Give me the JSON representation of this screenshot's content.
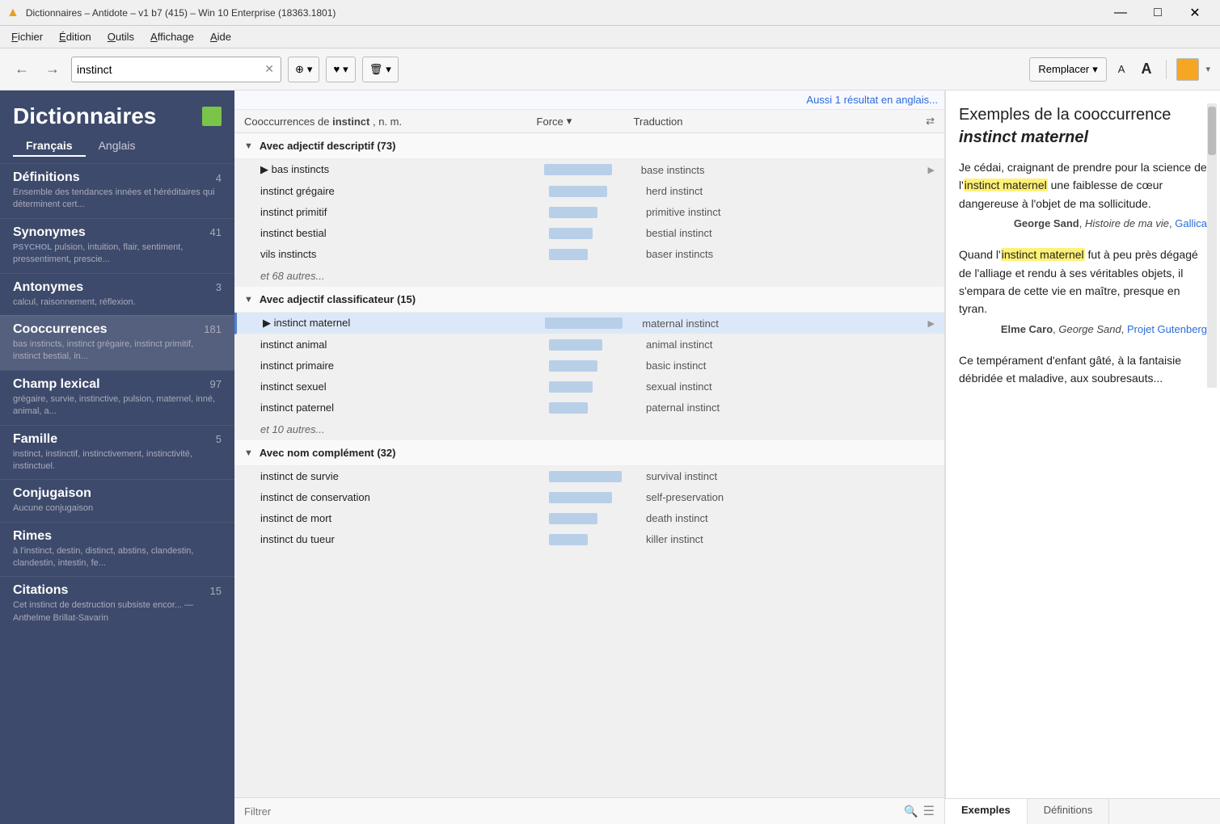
{
  "titleBar": {
    "icon": "▲",
    "title": "Dictionnaires – Antidote – v1 b7 (415) – Win 10 Enterprise (18363.1801)",
    "minimize": "—",
    "maximize": "□",
    "close": "✕"
  },
  "menuBar": {
    "items": [
      "Fichier",
      "Édition",
      "Outils",
      "Affichage",
      "Aide"
    ]
  },
  "toolbar": {
    "back": "←",
    "forward": "→",
    "searchValue": "instinct",
    "clear": "✕",
    "searchIcon": "⊕",
    "favoriteIcon": "♥",
    "deleteIcon": "🗑",
    "remplacer": "Remplacer",
    "fontSmall": "A",
    "fontLarge": "A",
    "dropdownArrow": "▾"
  },
  "sidebar": {
    "title": "Dictionnaires",
    "langTabs": [
      "Français",
      "Anglais"
    ],
    "activeLang": 0,
    "items": [
      {
        "title": "Définitions",
        "count": 4,
        "sub": "Ensemble des tendances innées et héréditaires qui déterminent cert..."
      },
      {
        "title": "Synonymes",
        "count": 41,
        "label": "PSYCHOL",
        "sub": "pulsion, intuition, flair, sentiment, pressentiment, prescie..."
      },
      {
        "title": "Antonymes",
        "count": 3,
        "sub": "calcul, raisonnement, réflexion."
      },
      {
        "title": "Cooccurrences",
        "count": 181,
        "sub": "bas instincts, instinct grégaire, instinct primitif, instinct bestial, in...",
        "active": true
      },
      {
        "title": "Champ lexical",
        "count": 97,
        "sub": "grégaire, survie, instinctive, pulsion, maternel, inné, animal, a..."
      },
      {
        "title": "Famille",
        "count": 5,
        "sub": "instinct, instinctif, instinctivement, instinctivité, instinctuel."
      },
      {
        "title": "Conjugaison",
        "count": null,
        "sub": "Aucune conjugaison"
      },
      {
        "title": "Rimes",
        "count": null,
        "sub": "à l'instinct, destin, distinct, abstins, clandestin, clandestin, intestin, fe..."
      },
      {
        "title": "Citations",
        "count": 15,
        "sub": "Cet instinct de destruction subsiste encor... — Anthelme Brillat-Savarin"
      }
    ]
  },
  "coocTable": {
    "englishLink": "Aussi 1 résultat en anglais...",
    "header": {
      "cooccurrences": "Cooccurrences de",
      "term": "instinct",
      "termSuffix": ", n. m.",
      "force": "Force",
      "traduction": "Traduction"
    },
    "sections": [
      {
        "title": "Avec adjectif descriptif (73)",
        "expanded": true,
        "rows": [
          {
            "fr": "bas instincts",
            "force": 70,
            "en": "base instincts",
            "hasArrow": true
          },
          {
            "fr": "instinct grégaire",
            "force": 60,
            "en": "herd instinct",
            "hasArrow": false
          },
          {
            "fr": "instinct primitif",
            "force": 50,
            "en": "primitive instinct",
            "hasArrow": false
          },
          {
            "fr": "instinct bestial",
            "force": 45,
            "en": "bestial instinct",
            "hasArrow": false
          },
          {
            "fr": "vils instincts",
            "force": 40,
            "en": "baser instincts",
            "hasArrow": false
          }
        ],
        "more": "et 68 autres..."
      },
      {
        "title": "Avec adjectif classificateur (15)",
        "expanded": true,
        "subsection": true,
        "rows": [
          {
            "fr": "instinct maternel",
            "force": 80,
            "en": "maternal instinct",
            "hasArrow": true,
            "selected": true
          },
          {
            "fr": "instinct animal",
            "force": 55,
            "en": "animal instinct",
            "hasArrow": false
          },
          {
            "fr": "instinct primaire",
            "force": 50,
            "en": "basic instinct",
            "hasArrow": false
          },
          {
            "fr": "instinct sexuel",
            "force": 45,
            "en": "sexual instinct",
            "hasArrow": false
          },
          {
            "fr": "instinct paternel",
            "force": 40,
            "en": "paternal instinct",
            "hasArrow": false
          }
        ],
        "more": "et 10 autres..."
      },
      {
        "title": "Avec nom complément (32)",
        "expanded": true,
        "rows": [
          {
            "fr": "instinct de survie",
            "force": 75,
            "en": "survival instinct",
            "hasArrow": false
          },
          {
            "fr": "instinct de conservation",
            "force": 65,
            "en": "self-preservation",
            "hasArrow": false
          },
          {
            "fr": "instinct de mort",
            "force": 50,
            "en": "death instinct",
            "hasArrow": false
          },
          {
            "fr": "instinct du tueur",
            "force": 40,
            "en": "killer instinct",
            "hasArrow": false
          }
        ]
      }
    ],
    "filter": {
      "placeholder": "Filtrer",
      "searchIcon": "🔍"
    }
  },
  "rightPanel": {
    "title": "Exemples de la cooccurrence",
    "titleBold": "instinct maternel",
    "examples": [
      {
        "text": "Je cédai, craignant de prendre pour la science de l'instinct maternel une faiblesse de cœur dangereuse à l'objet de ma sollicitude.",
        "highlight": "instinct maternel",
        "author": "George Sand",
        "work": "Histoire de ma vie",
        "publisher": "Gallica",
        "publisherLink": true
      },
      {
        "text": "Quand l'instinct maternel fut à peu près dégagé de l'alliage et rendu à ses véritables objets, il s'empara de cette vie en maître, presque en tyran.",
        "highlight": "instinct maternel",
        "author": "Elme Caro",
        "work": "George Sand",
        "publisher": "Projet Gutenberg",
        "publisherLink": true
      },
      {
        "text": "Ce tempérament d'enfant gâté, à la fantaisie débridée et maladive, aux soubresauts...",
        "highlight": null
      }
    ],
    "bottomTabs": [
      "Exemples",
      "Définitions"
    ]
  }
}
